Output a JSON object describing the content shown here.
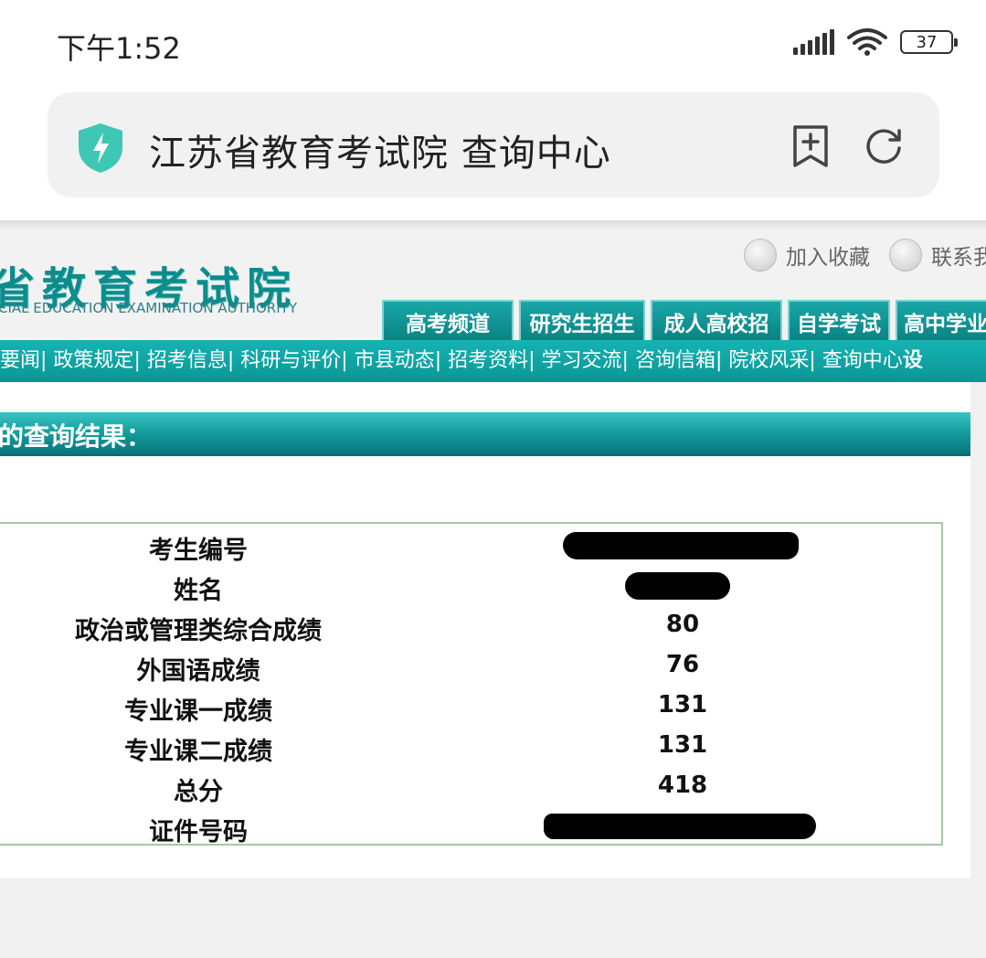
{
  "status_bar": {
    "time": "下午1:52",
    "battery": "37"
  },
  "browser": {
    "page_title": "江苏省教育考试院 查询中心"
  },
  "site": {
    "logo_cn": "省教育考试院",
    "logo_en": "CIAL EDUCATION EXAMINATION AUTHORITY",
    "top_links": [
      "加入收藏",
      "联系我"
    ],
    "channel_tabs": [
      "高考频道",
      "研究生招生",
      "成人高校招",
      "自学考试",
      "高中学业"
    ],
    "nav_items": [
      "要闻",
      "政策规定",
      "招考信息",
      "科研与评价",
      "市县动态",
      "招考资料",
      "学习交流",
      "咨询信箱",
      "院校风采",
      "查询中心"
    ],
    "nav_tail": "设"
  },
  "result": {
    "title": "的查询结果：",
    "rows": [
      {
        "label": "考生编号",
        "value": ""
      },
      {
        "label": "姓名",
        "value": ""
      },
      {
        "label": "政治或管理类综合成绩",
        "value": "80"
      },
      {
        "label": "外国语成绩",
        "value": "76"
      },
      {
        "label": "专业课一成绩",
        "value": "131"
      },
      {
        "label": "专业课二成绩",
        "value": "131"
      },
      {
        "label": "总分",
        "value": "418"
      },
      {
        "label": "证件号码",
        "value": ""
      }
    ]
  },
  "colors": {
    "teal": "#0c9595",
    "teal_dark": "#08757c",
    "table_border": "#a9c6a9"
  },
  "icons": [
    "signal-icon",
    "wifi-icon",
    "battery-icon",
    "shield-icon",
    "bookmark-add-icon",
    "reload-icon",
    "folder-icon",
    "home-icon"
  ]
}
